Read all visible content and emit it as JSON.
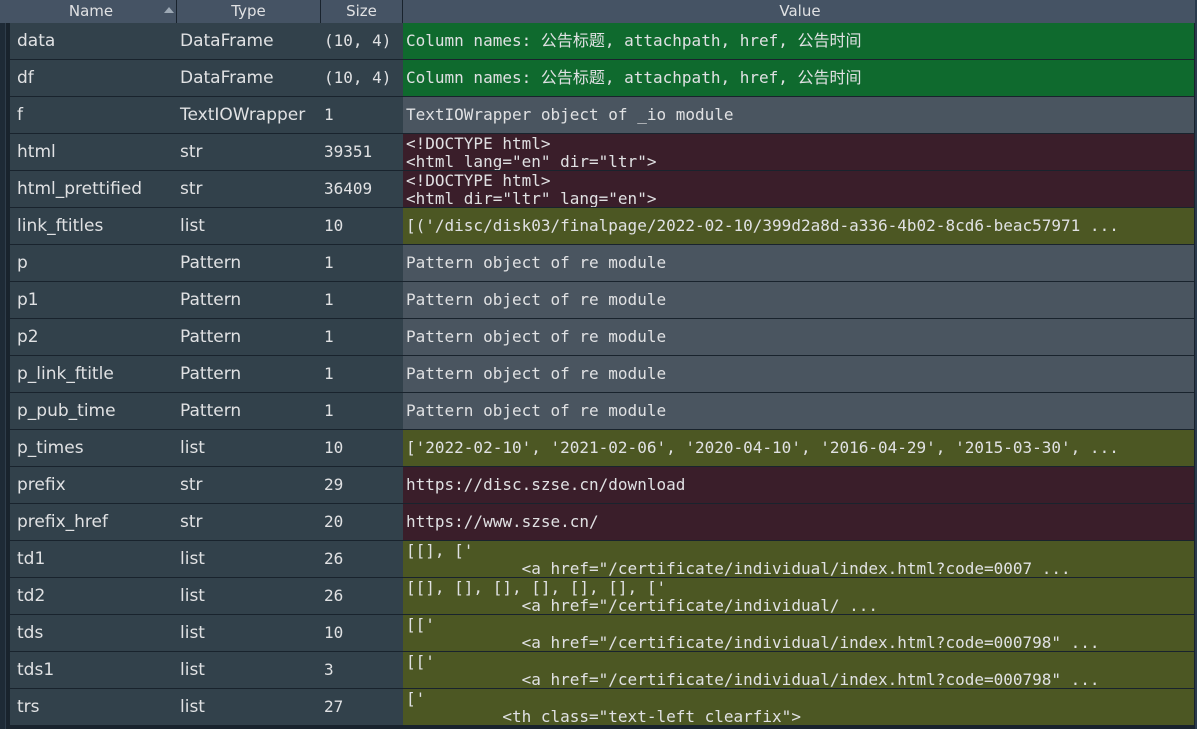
{
  "header": {
    "name": "Name",
    "type": "Type",
    "size": "Size",
    "value": "Value"
  },
  "colors": {
    "dataframe": "#0f6a2e",
    "object": "#4a5560",
    "str": "#3a1e2a",
    "list": "#4c5723"
  },
  "rows": [
    {
      "name": "data",
      "type": "DataFrame",
      "size": "(10, 4)",
      "kind": "dataframe",
      "v1": "Column names: 公告标题, attachpath, href, 公告时间",
      "v2": ""
    },
    {
      "name": "df",
      "type": "DataFrame",
      "size": "(10, 4)",
      "kind": "dataframe",
      "v1": "Column names: 公告标题, attachpath, href, 公告时间",
      "v2": ""
    },
    {
      "name": "f",
      "type": "TextIOWrapper",
      "size": "1",
      "kind": "object",
      "v1": "TextIOWrapper object of _io module",
      "v2": ""
    },
    {
      "name": "html",
      "type": "str",
      "size": "39351",
      "kind": "str",
      "v1": "<!DOCTYPE html>",
      "v2": "<html lang=\"en\" dir=\"ltr\">"
    },
    {
      "name": "html_prettified",
      "type": "str",
      "size": "36409",
      "kind": "str",
      "v1": "<!DOCTYPE html>",
      "v2": "<html dir=\"ltr\" lang=\"en\">"
    },
    {
      "name": "link_ftitles",
      "type": "list",
      "size": "10",
      "kind": "list",
      "v1": "[('/disc/disk03/finalpage/2022-02-10/399d2a8d-a336-4b02-8cd6-beac57971 ...",
      "v2": ""
    },
    {
      "name": "p",
      "type": "Pattern",
      "size": "1",
      "kind": "object",
      "v1": "Pattern object of re module",
      "v2": ""
    },
    {
      "name": "p1",
      "type": "Pattern",
      "size": "1",
      "kind": "object",
      "v1": "Pattern object of re module",
      "v2": ""
    },
    {
      "name": "p2",
      "type": "Pattern",
      "size": "1",
      "kind": "object",
      "v1": "Pattern object of re module",
      "v2": ""
    },
    {
      "name": "p_link_ftitle",
      "type": "Pattern",
      "size": "1",
      "kind": "object",
      "v1": "Pattern object of re module",
      "v2": ""
    },
    {
      "name": "p_pub_time",
      "type": "Pattern",
      "size": "1",
      "kind": "object",
      "v1": "Pattern object of re module",
      "v2": ""
    },
    {
      "name": "p_times",
      "type": "list",
      "size": "10",
      "kind": "list",
      "v1": "['2022-02-10', '2021-02-06', '2020-04-10', '2016-04-29', '2015-03-30', ...",
      "v2": ""
    },
    {
      "name": "prefix",
      "type": "str",
      "size": "29",
      "kind": "str",
      "v1": "https://disc.szse.cn/download",
      "v2": ""
    },
    {
      "name": "prefix_href",
      "type": "str",
      "size": "20",
      "kind": "str",
      "v1": "https://www.szse.cn/",
      "v2": ""
    },
    {
      "name": "td1",
      "type": "list",
      "size": "26",
      "kind": "list",
      "v1": "[[], ['",
      "v2": "            <a href=\"/certificate/individual/index.html?code=0007 ..."
    },
    {
      "name": "td2",
      "type": "list",
      "size": "26",
      "kind": "list",
      "v1": "[[], [], [], [], [], [], ['",
      "v2": "            <a href=\"/certificate/individual/ ..."
    },
    {
      "name": "tds",
      "type": "list",
      "size": "10",
      "kind": "list",
      "v1": "[['",
      "v2": "            <a href=\"/certificate/individual/index.html?code=000798\" ..."
    },
    {
      "name": "tds1",
      "type": "list",
      "size": "3",
      "kind": "list",
      "v1": "[['",
      "v2": "            <a href=\"/certificate/individual/index.html?code=000798\" ..."
    },
    {
      "name": "trs",
      "type": "list",
      "size": "27",
      "kind": "list",
      "v1": "['",
      "v2": "          <th class=\"text-left clearfix\">"
    }
  ]
}
